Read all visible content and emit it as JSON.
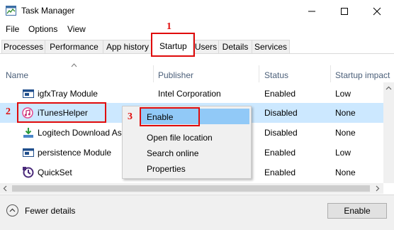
{
  "window": {
    "title": "Task Manager"
  },
  "menu": [
    "File",
    "Options",
    "View"
  ],
  "tabs": [
    "Processes",
    "Performance",
    "App history",
    "Startup",
    "Users",
    "Details",
    "Services"
  ],
  "columns": {
    "name": "Name",
    "publisher": "Publisher",
    "status": "Status",
    "impact": "Startup impact"
  },
  "rows": [
    {
      "name": "igfxTray Module",
      "publisher": "Intel Corporation",
      "status": "Enabled",
      "impact": "Low"
    },
    {
      "name": "iTunesHelper",
      "publisher": "",
      "status": "Disabled",
      "impact": "None"
    },
    {
      "name": "Logitech Download As",
      "publisher": "",
      "status": "Disabled",
      "impact": "None"
    },
    {
      "name": "persistence Module",
      "publisher": "",
      "status": "Enabled",
      "impact": "Low"
    },
    {
      "name": "QuickSet",
      "publisher": "",
      "status": "Enabled",
      "impact": "None"
    }
  ],
  "context_menu": [
    "Enable",
    "Open file location",
    "Search online",
    "Properties"
  ],
  "annotations": [
    "1",
    "2",
    "3"
  ],
  "footer": {
    "fewer_details": "Fewer details",
    "enable_button": "Enable"
  },
  "colors": {
    "annotation_red": "#e00b0b",
    "row_selected": "#cce8ff",
    "menu_highlight": "#91c9f7",
    "header_text": "#4c607a"
  }
}
